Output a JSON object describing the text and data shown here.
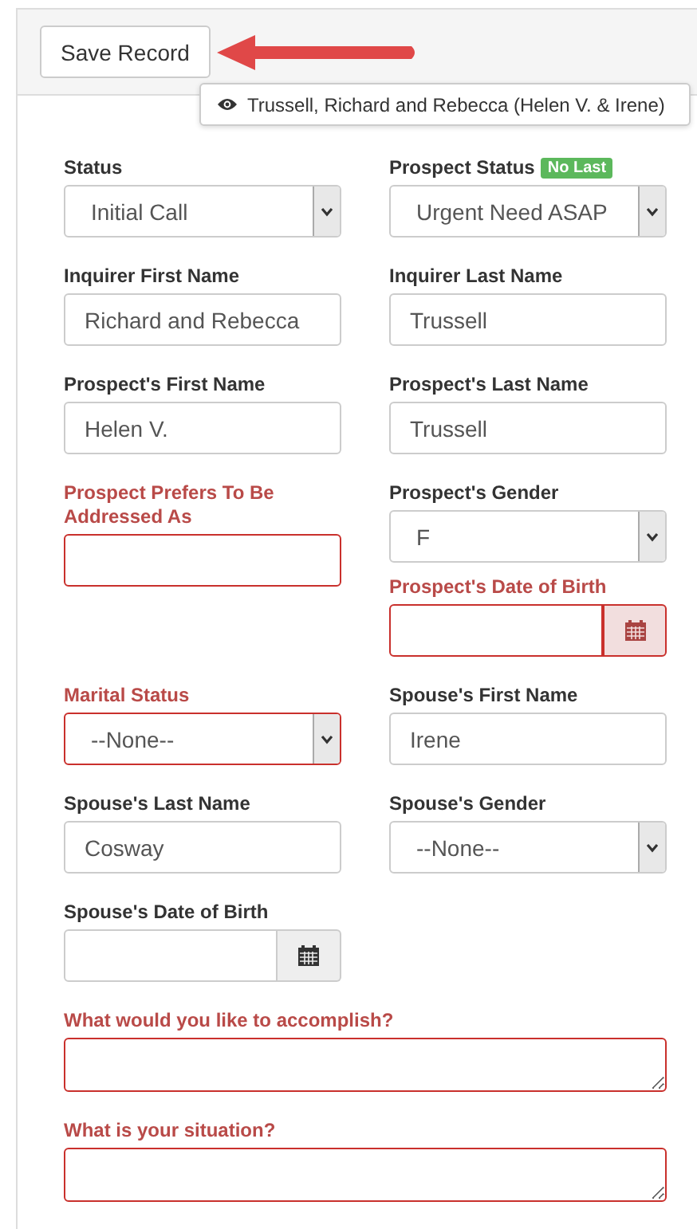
{
  "toolbar": {
    "save_button": "Save Record"
  },
  "record_title": "Trussell, Richard and Rebecca (Helen V. & Irene)",
  "rows": [
    [
      {
        "fields": [
          {
            "label": "Status",
            "kind": "select",
            "value": "Initial Call",
            "required": false
          }
        ]
      },
      {
        "fields": [
          {
            "label": "Prospect Status",
            "badge": "No Last",
            "kind": "select",
            "value": "Urgent Need ASAP",
            "required": false
          }
        ]
      }
    ],
    [
      {
        "fields": [
          {
            "label": "Inquirer First Name",
            "kind": "text",
            "value": "Richard and Rebecca",
            "required": false
          }
        ]
      },
      {
        "fields": [
          {
            "label": "Inquirer Last Name",
            "kind": "text",
            "value": "Trussell",
            "required": false
          }
        ]
      }
    ],
    [
      {
        "fields": [
          {
            "label": "Prospect's First Name",
            "kind": "text",
            "value": "Helen V.",
            "required": false
          }
        ]
      },
      {
        "fields": [
          {
            "label": "Prospect's Last Name",
            "kind": "text",
            "value": "Trussell",
            "required": false
          }
        ]
      }
    ],
    [
      {
        "fields": [
          {
            "label": "Prospect Prefers To Be Addressed As",
            "kind": "text",
            "required": true
          }
        ]
      },
      {
        "fields": [
          {
            "label": "Prospect's Gender",
            "kind": "select",
            "value": "F",
            "required": false
          },
          {
            "label": "Prospect's Date of Birth",
            "kind": "date",
            "required": true
          }
        ]
      }
    ],
    [
      {
        "fields": [
          {
            "label": "Marital Status",
            "kind": "select",
            "value": "--None--",
            "required": true
          }
        ]
      },
      {
        "fields": [
          {
            "label": "Spouse's First Name",
            "kind": "text",
            "value": "Irene",
            "required": false
          }
        ]
      }
    ],
    [
      {
        "fields": [
          {
            "label": "Spouse's Last Name",
            "kind": "text",
            "value": "Cosway",
            "required": false
          }
        ]
      },
      {
        "fields": [
          {
            "label": "Spouse's Gender",
            "kind": "select",
            "value": "--None--",
            "required": false
          }
        ]
      }
    ],
    [
      {
        "fields": [
          {
            "label": "Spouse's Date of Birth",
            "kind": "date",
            "required": false
          }
        ]
      }
    ],
    [
      {
        "fields": [
          {
            "label": "What would you like to accomplish?",
            "kind": "textarea",
            "required": true
          }
        ]
      }
    ],
    [
      {
        "fields": [
          {
            "label": "What is your situation?",
            "kind": "textarea",
            "required": true
          }
        ]
      }
    ]
  ]
}
